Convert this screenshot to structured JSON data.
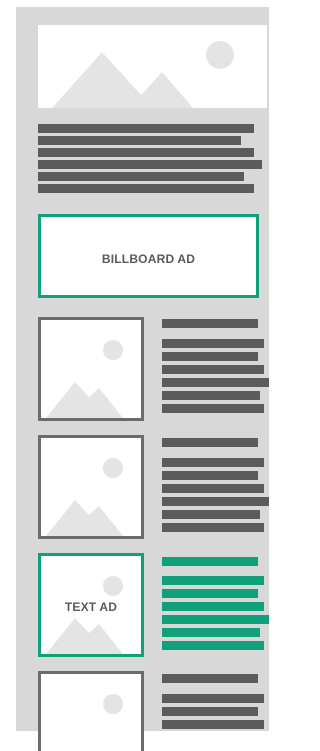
{
  "colors": {
    "background": "#d8d8d8",
    "text_bar": "#5b5b5b",
    "ad_accent": "#10a07a",
    "image_border": "#6b6b6b"
  },
  "billboard": {
    "label": "BILLBOARD AD"
  },
  "text_ad": {
    "label": "TEXT AD"
  },
  "icons": [
    "image-placeholder-icon"
  ]
}
